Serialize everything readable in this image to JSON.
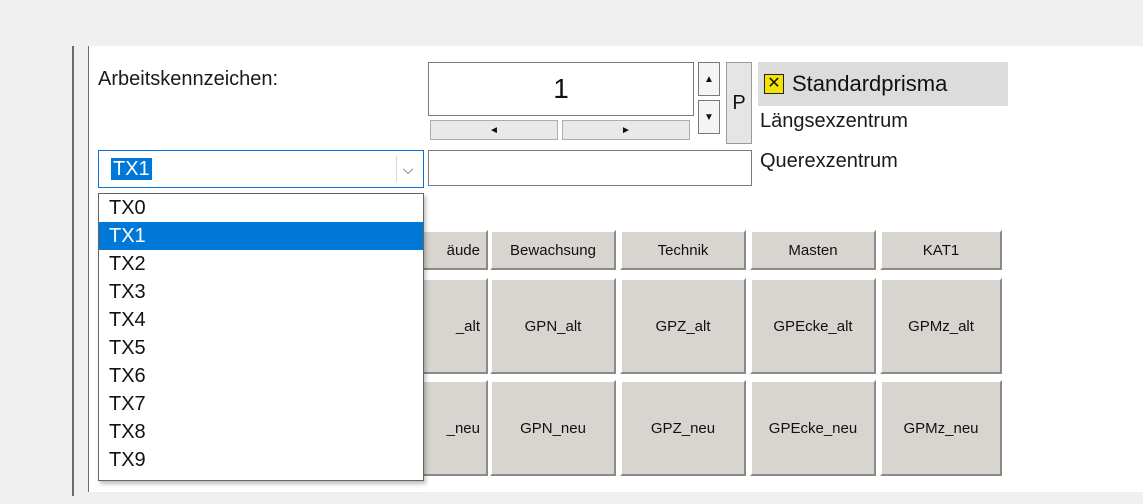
{
  "form": {
    "arbeitskennzeichen_label": "Arbeitskennzeichen:",
    "number_value": "1",
    "p_button": "P",
    "prism": {
      "label": "Standardprisma",
      "icon": "yellow-x-icon"
    },
    "laengsexzentrum_label": "Längsexzentrum",
    "querexzentrum_label": "Querexzentrum",
    "querexzentrum_value": "",
    "spin_up": "▲",
    "spin_down": "▼",
    "scroll_left": "◄",
    "scroll_right": "►"
  },
  "combo": {
    "value": "TX1",
    "arrow": "⌵",
    "options": [
      "TX0",
      "TX1",
      "TX2",
      "TX3",
      "TX4",
      "TX5",
      "TX6",
      "TX7",
      "TX8",
      "TX9"
    ],
    "selected_index": 1
  },
  "buttons": {
    "row1": [
      "äude",
      "Bewachsung",
      "Technik",
      "Masten",
      "KAT1"
    ],
    "row2": [
      "_alt",
      "GPN_alt",
      "GPZ_alt",
      "GPEcke_alt",
      "GPMz_alt"
    ],
    "row3": [
      "_neu",
      "GPN_neu",
      "GPZ_neu",
      "GPEcke_neu",
      "GPMz_neu"
    ]
  },
  "colors": {
    "selection": "#0078d7",
    "button_face": "#d8d5d0",
    "prism_icon": "#f2e300"
  }
}
